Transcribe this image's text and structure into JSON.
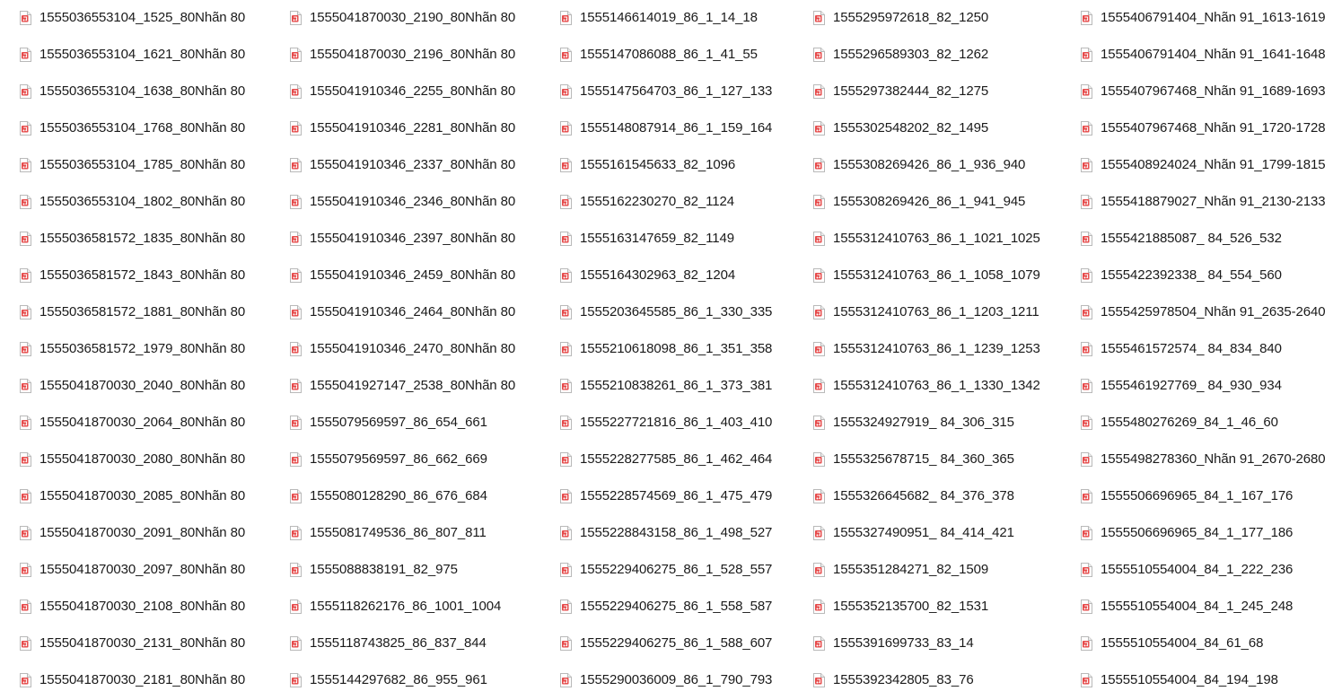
{
  "icon": {
    "name": "audio-file-icon",
    "color": "#e64a4a"
  },
  "columns": [
    {
      "files": [
        "1555036553104_1525_80Nhãn 80",
        "1555036553104_1621_80Nhãn 80",
        "1555036553104_1638_80Nhãn 80",
        "1555036553104_1768_80Nhãn 80",
        "1555036553104_1785_80Nhãn 80",
        "1555036553104_1802_80Nhãn 80",
        "1555036581572_1835_80Nhãn 80",
        "1555036581572_1843_80Nhãn 80",
        "1555036581572_1881_80Nhãn 80",
        "1555036581572_1979_80Nhãn 80",
        "1555041870030_2040_80Nhãn 80",
        "1555041870030_2064_80Nhãn 80",
        "1555041870030_2080_80Nhãn 80",
        "1555041870030_2085_80Nhãn 80",
        "1555041870030_2091_80Nhãn 80",
        "1555041870030_2097_80Nhãn 80",
        "1555041870030_2108_80Nhãn 80",
        "1555041870030_2131_80Nhãn 80",
        "1555041870030_2181_80Nhãn 80"
      ]
    },
    {
      "files": [
        "1555041870030_2190_80Nhãn 80",
        "1555041870030_2196_80Nhãn 80",
        "1555041910346_2255_80Nhãn 80",
        "1555041910346_2281_80Nhãn 80",
        "1555041910346_2337_80Nhãn 80",
        "1555041910346_2346_80Nhãn 80",
        "1555041910346_2397_80Nhãn 80",
        "1555041910346_2459_80Nhãn 80",
        "1555041910346_2464_80Nhãn 80",
        "1555041910346_2470_80Nhãn 80",
        "1555041927147_2538_80Nhãn 80",
        "1555079569597_86_654_661",
        "1555079569597_86_662_669",
        "1555080128290_86_676_684",
        "1555081749536_86_807_811",
        "1555088838191_82_975",
        "1555118262176_86_1001_1004",
        "1555118743825_86_837_844",
        "1555144297682_86_955_961"
      ]
    },
    {
      "files": [
        "1555146614019_86_1_14_18",
        "1555147086088_86_1_41_55",
        "1555147564703_86_1_127_133",
        "1555148087914_86_1_159_164",
        "1555161545633_82_1096",
        "1555162230270_82_1124",
        "1555163147659_82_1149",
        "1555164302963_82_1204",
        "1555203645585_86_1_330_335",
        "1555210618098_86_1_351_358",
        "1555210838261_86_1_373_381",
        "1555227721816_86_1_403_410",
        "1555228277585_86_1_462_464",
        "1555228574569_86_1_475_479",
        "1555228843158_86_1_498_527",
        "1555229406275_86_1_528_557",
        "1555229406275_86_1_558_587",
        "1555229406275_86_1_588_607",
        "1555290036009_86_1_790_793"
      ]
    },
    {
      "files": [
        "1555295972618_82_1250",
        "1555296589303_82_1262",
        "1555297382444_82_1275",
        "1555302548202_82_1495",
        "1555308269426_86_1_936_940",
        "1555308269426_86_1_941_945",
        "1555312410763_86_1_1021_1025",
        "1555312410763_86_1_1058_1079",
        "1555312410763_86_1_1203_1211",
        "1555312410763_86_1_1239_1253",
        "1555312410763_86_1_1330_1342",
        "1555324927919_ 84_306_315",
        "1555325678715_ 84_360_365",
        "1555326645682_ 84_376_378",
        "1555327490951_ 84_414_421",
        "1555351284271_82_1509",
        "1555352135700_82_1531",
        "1555391699733_83_14",
        "1555392342805_83_76"
      ]
    },
    {
      "files": [
        "1555406791404_Nhãn 91_1613-1619",
        "1555406791404_Nhãn 91_1641-1648",
        "1555407967468_Nhãn 91_1689-1693",
        "1555407967468_Nhãn 91_1720-1728",
        "1555408924024_Nhãn 91_1799-1815",
        "1555418879027_Nhãn 91_2130-2133",
        "1555421885087_ 84_526_532",
        "1555422392338_ 84_554_560",
        "1555425978504_Nhãn 91_2635-2640",
        "1555461572574_ 84_834_840",
        "1555461927769_ 84_930_934",
        "1555480276269_84_1_46_60",
        "1555498278360_Nhãn 91_2670-2680",
        "1555506696965_84_1_167_176",
        "1555506696965_84_1_177_186",
        "1555510554004_84_1_222_236",
        "1555510554004_84_1_245_248",
        "1555510554004_84_61_68",
        "1555510554004_84_194_198"
      ]
    }
  ]
}
